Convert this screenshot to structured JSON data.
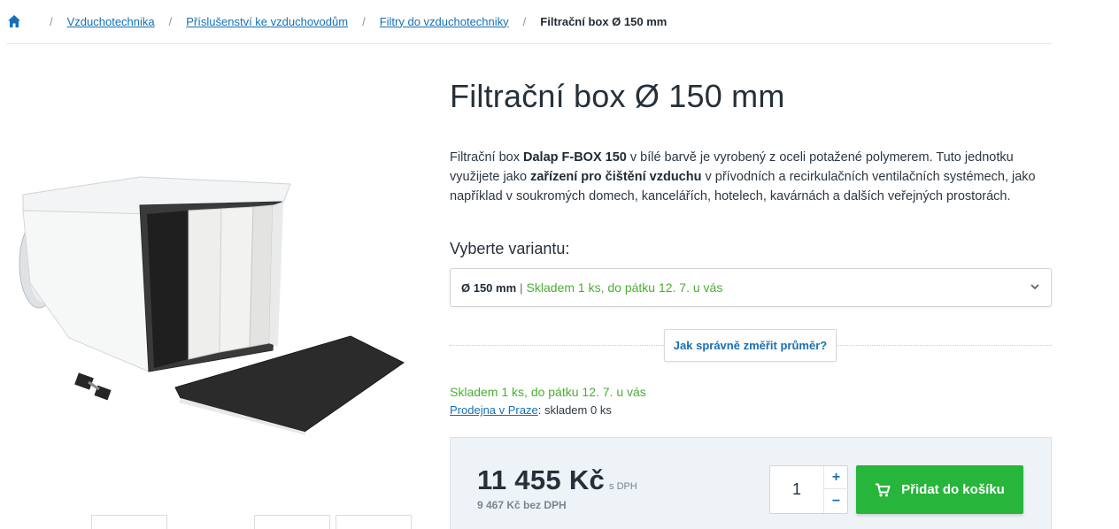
{
  "breadcrumb": {
    "items": [
      {
        "label": "Vzduchotechnika"
      },
      {
        "label": "Příslušenství ke vzduchovodům"
      },
      {
        "label": "Filtry do vzduchotechniky"
      }
    ],
    "separator": "/",
    "current": "Filtrační box Ø 150 mm"
  },
  "product": {
    "title": "Filtrační box Ø 150 mm",
    "description": {
      "p1": "Filtrační box ",
      "b1": "Dalap F-BOX 150",
      "p2": " v bílé barvě je vyrobený z oceli potažené polymerem. Tuto jednotku využijete jako ",
      "b2": "zařízení pro čištění vzduchu",
      "p3": " v přívodních a recirkulačních ventilačních systémech, jako například v soukromých domech, kancelářích, hotelech, kavárnách a dalších veřejných prostorách."
    }
  },
  "variant": {
    "label": "Vyberte variantu:",
    "selected_size": "Ø 150 mm",
    "separator": "|",
    "selected_stock": "Skladem 1 ks, do pátku 12. 7. u vás"
  },
  "measure_button": "Jak správně změřit průměr?",
  "availability": {
    "stock": "Skladem 1 ks, do pátku 12. 7. u vás",
    "store_link": "Prodejna v Praze",
    "store_status": ": skladem 0 ks"
  },
  "price": {
    "amount": "11 455 Kč",
    "vat_label": "s DPH",
    "without_vat": "9 467 Kč bez DPH"
  },
  "quantity": {
    "value": "1",
    "plus": "+",
    "minus": "−"
  },
  "add_to_cart": "Přidat do košíku",
  "colors": {
    "link": "#1570b5",
    "stock_green": "#4aae32",
    "button_green": "#27b53c",
    "price_box_bg": "#eef3f7"
  },
  "icons": {
    "home": "home-icon",
    "chevron": "chevron-down-icon",
    "cart": "cart-icon"
  }
}
